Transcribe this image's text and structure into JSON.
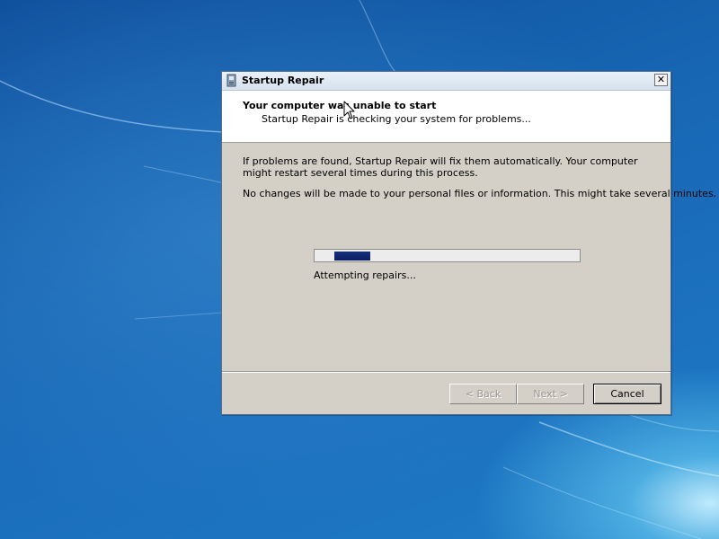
{
  "window": {
    "title": "Startup Repair",
    "close_label": "✕"
  },
  "header": {
    "title": "Your computer was unable to start",
    "subtitle": "Startup Repair is checking your system for problems..."
  },
  "body": {
    "paragraph1": "If problems are found, Startup Repair will fix them automatically. Your computer might restart several times during this process.",
    "paragraph2": "No changes will be made to your personal files or information. This might take several minutes."
  },
  "progress": {
    "style": "marquee",
    "status_text": "Attempting repairs..."
  },
  "buttons": {
    "back_label": "< Back",
    "next_label": "Next >",
    "cancel_label": "Cancel"
  },
  "icons": {
    "title_icon": "startup-repair-icon",
    "cursor": "mouse-pointer"
  },
  "colors": {
    "dialog_bg": "#d4d0c8",
    "progress_chunk": "#0a1f60",
    "desktop": "#1766b3"
  }
}
